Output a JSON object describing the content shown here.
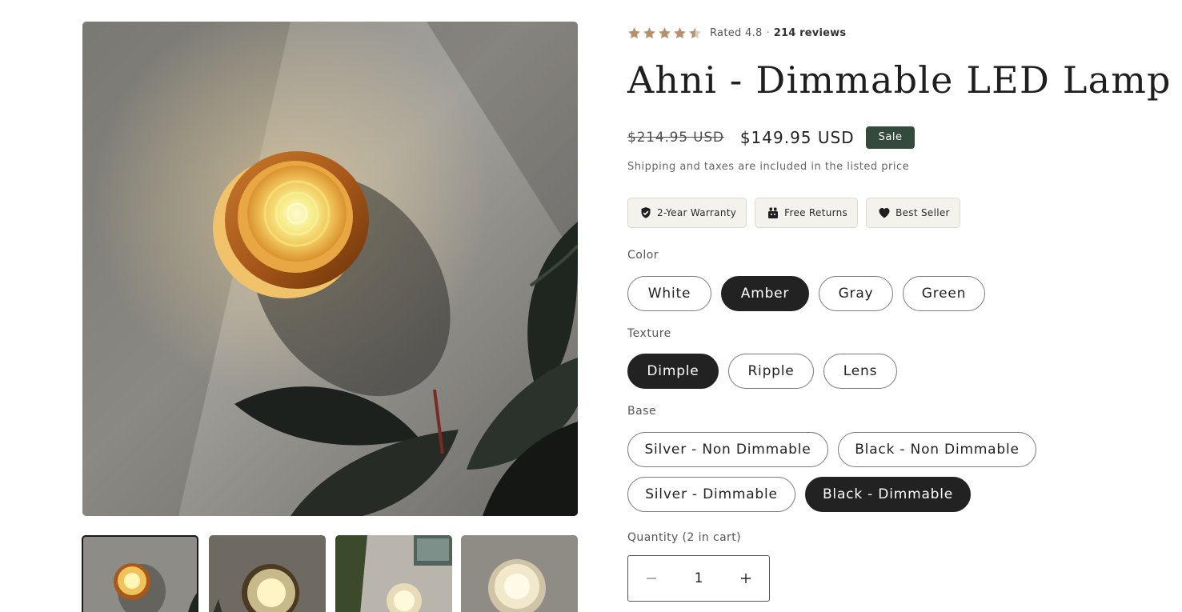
{
  "product": {
    "rating": {
      "stars": 4.5,
      "text": "Rated 4.8",
      "separator": "·",
      "count_label": "214 reviews",
      "star_color": "#b5906a"
    },
    "title": "Ahni - Dimmable LED Lamp",
    "price": {
      "compare_at": "$214.95 USD",
      "current": "$149.95 USD",
      "badge": "Sale",
      "badge_color": "#334a3c"
    },
    "shipping_note": "Shipping and taxes are included in the listed price",
    "trust_badges": [
      {
        "icon": "shield-check-icon",
        "label": "2-Year Warranty"
      },
      {
        "icon": "gift-box-icon",
        "label": "Free Returns"
      },
      {
        "icon": "heart-icon",
        "label": "Best Seller"
      }
    ],
    "options": {
      "color": {
        "label": "Color",
        "values": [
          "White",
          "Amber",
          "Gray",
          "Green"
        ],
        "selected": "Amber"
      },
      "texture": {
        "label": "Texture",
        "values": [
          "Dimple",
          "Ripple",
          "Lens"
        ],
        "selected": "Dimple"
      },
      "base": {
        "label": "Base",
        "values": [
          "Silver - Non Dimmable",
          "Black - Non Dimmable",
          "Silver - Dimmable",
          "Black - Dimmable"
        ],
        "selected": "Black - Dimmable"
      }
    },
    "quantity": {
      "label": "Quantity (2 in cart)",
      "value": "1",
      "decrease_icon": "minus-icon",
      "increase_icon": "plus-icon"
    }
  },
  "gallery": {
    "main_image": "amber-lamp-on-wall-with-plant",
    "thumbnails": [
      "amber-lamp",
      "smoke-lamp",
      "white-lamp-hallway",
      "white-lamp-closeup"
    ],
    "active_thumbnail": 0
  }
}
